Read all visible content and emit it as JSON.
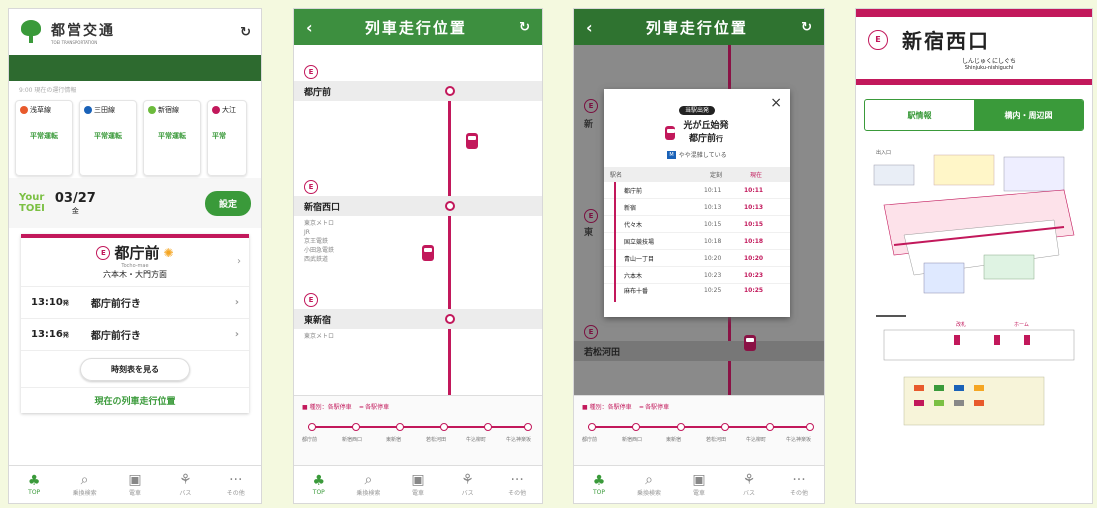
{
  "p1": {
    "logo_text": "都営交通",
    "logo_sub": "TOEI TRANSPORTATION",
    "sub_note": "9:00 現在の運行情報",
    "lines": [
      {
        "name": "浅草線",
        "status": "平常運転",
        "color": "#e85a2c"
      },
      {
        "name": "三田線",
        "status": "平常運転",
        "color": "#1a62b8"
      },
      {
        "name": "新宿線",
        "status": "平常運転",
        "color": "#6cbb3c"
      },
      {
        "name": "大江",
        "status": "平常",
        "color": "#c2185b"
      }
    ],
    "your1": "Your",
    "your2": "TOEI",
    "date": "03/27",
    "day": "金",
    "settings_label": "設定",
    "station": "都庁前",
    "station_reading": "Tocho-mae",
    "direction": "六本木・大門方面",
    "departures": [
      {
        "time": "13:10",
        "suffix": "発",
        "dest": "都庁前行き"
      },
      {
        "time": "13:16",
        "suffix": "発",
        "dest": "都庁前行き"
      }
    ],
    "timetable_btn": "時刻表を見る",
    "position_link": "現在の列車走行位置"
  },
  "tabs": [
    "TOP",
    "乗換検索",
    "電車",
    "バス",
    "その他"
  ],
  "p2": {
    "title": "列車走行位置",
    "stations": [
      {
        "name": "都庁前",
        "note": ""
      },
      {
        "name": "新宿西口",
        "note": "東京メトロ\nJR\n京王電鉄\n小田急電鉄\n西武鉄道"
      },
      {
        "name": "東新宿",
        "note": "東京メトロ"
      }
    ],
    "legend_a": "■ 種別：各駅停車",
    "legend_b": "━ 各駅停車",
    "mini_stations": [
      "都庁前",
      "新宿西口",
      "東新宿",
      "若松河田",
      "牛込柳町",
      "牛込神楽坂"
    ]
  },
  "p3": {
    "title": "列車走行位置",
    "popup_badge": "当駅出発",
    "popup_from": "光が丘始発",
    "popup_dest": "都庁前",
    "popup_dest_suffix": "行",
    "popup_crowd": "やや混雑している",
    "popup_cols": [
      "駅名",
      "",
      "定刻",
      "現在"
    ],
    "popup_rows": [
      {
        "stn": "都庁前",
        "sched": "10:11",
        "now": "10:11"
      },
      {
        "stn": "新宿",
        "sched": "10:13",
        "now": "10:13"
      },
      {
        "stn": "代々木",
        "sched": "10:15",
        "now": "10:15"
      },
      {
        "stn": "国立競技場",
        "sched": "10:18",
        "now": "10:18"
      },
      {
        "stn": "青山一丁目",
        "sched": "10:20",
        "now": "10:20"
      },
      {
        "stn": "六本木",
        "sched": "10:23",
        "now": "10:23"
      },
      {
        "stn": "麻布十番",
        "sched": "10:25",
        "now": "10:25"
      }
    ],
    "bg_stations": [
      "新",
      "東",
      "若松河田"
    ]
  },
  "p4": {
    "station": "新宿西口",
    "reading_kana": "しんじゅくにしぐち",
    "reading_roman": "Shinjuku-nishiguchi",
    "btn_info": "駅情報",
    "btn_map": "構内・周辺図",
    "map_label_a": "出入口",
    "map_label_b": "改札",
    "map_label_c": "ホーム"
  }
}
